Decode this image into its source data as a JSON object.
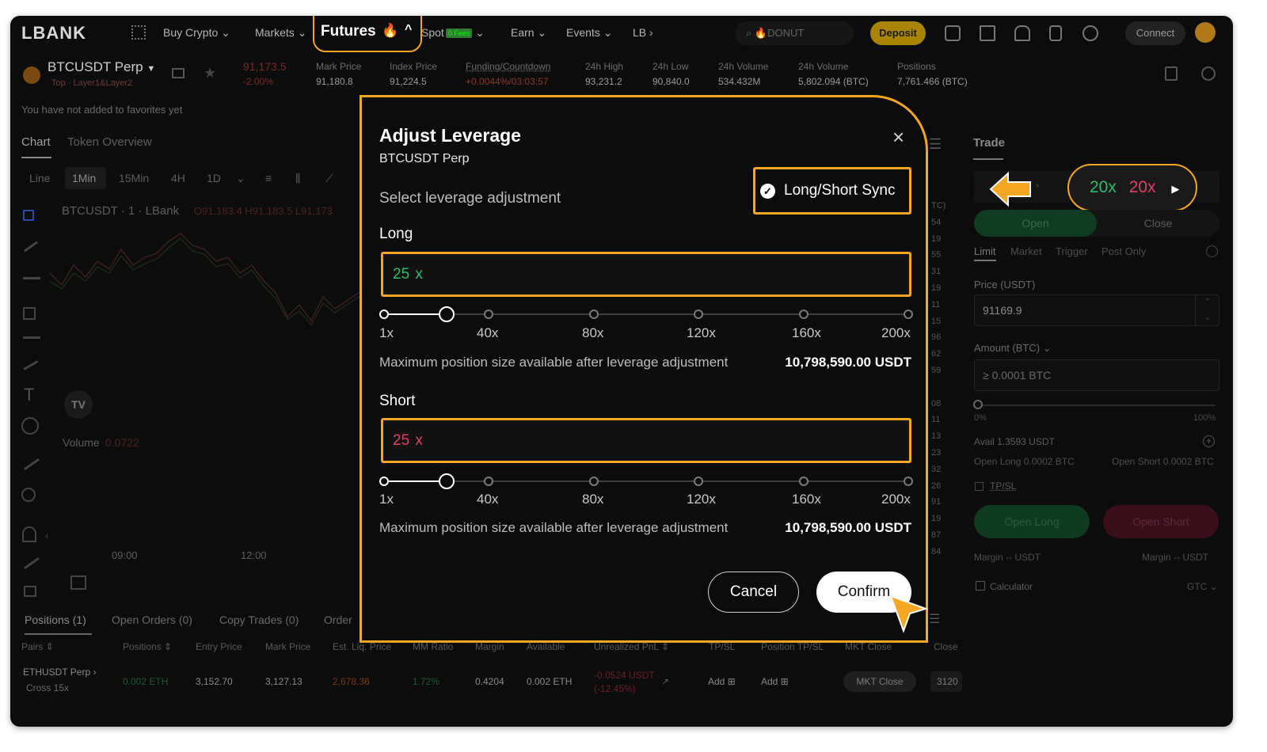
{
  "nav": {
    "logo": "LBANK",
    "items": [
      "Buy Crypto ⌄",
      "Markets ⌄",
      "Futures",
      "Spot",
      "Earn ⌄",
      "Events ⌄",
      "LB"
    ],
    "spot_badge": "0 Fees",
    "search_placeholder": "DONUT",
    "deposit": "Deposit",
    "connect": "Connect"
  },
  "ticker": {
    "symbol": "BTCUSDT Perp",
    "tags": "Top · Layer1&Layer2",
    "price": "91,173.5",
    "change": "-2.00%",
    "fields": [
      {
        "label": "Mark Price",
        "value": "91,180.8"
      },
      {
        "label": "Index Price",
        "value": "91,224.5"
      },
      {
        "label": "Funding/Countdown",
        "value": "+0.0044%/03:03:57"
      },
      {
        "label": "24h High",
        "value": "93,231.2"
      },
      {
        "label": "24h Low",
        "value": "90,840.0"
      },
      {
        "label": "24h Volume",
        "value": "534.432M"
      },
      {
        "label": "24h Volume",
        "value": "5,802.094 (BTC)"
      },
      {
        "label": "Positions",
        "value": "7,761.466 (BTC)"
      }
    ],
    "favorites_msg": "You have not added to favorites yet"
  },
  "chart": {
    "tabs": [
      "Chart",
      "Token Overview"
    ],
    "intervals": [
      "Line",
      "1Min",
      "15Min",
      "4H",
      "1D"
    ],
    "legend": "BTCUSDT · 1 · LBank",
    "ohlc": "O91,183.4  H91,183.5  L91,173",
    "volume_label": "Volume",
    "volume_value": "0.0722",
    "times": [
      "09:00",
      "12:00"
    ]
  },
  "modal": {
    "title": "Adjust Leverage",
    "subtitle": "BTCUSDT Perp",
    "select_label": "Select leverage adjustment",
    "sync_label": "Long/Short Sync",
    "long_label": "Long",
    "short_label": "Short",
    "long_value": "25",
    "short_value": "25",
    "unit": "x",
    "ticks": [
      "1x",
      "40x",
      "80x",
      "120x",
      "160x",
      "200x"
    ],
    "long_fraction": 0.12,
    "short_fraction": 0.12,
    "max_label": "Maximum position size available after leverage adjustment",
    "max_value_long": "10,798,590.00 USDT",
    "max_value_short": "10,798,590.00 USDT",
    "cancel": "Cancel",
    "confirm": "Confirm"
  },
  "trade": {
    "title": "Trade",
    "lev_long": "20x",
    "lev_short": "20x",
    "mode_fragment": "ss",
    "open": "Open",
    "close": "Close",
    "order_types": [
      "Limit",
      "Market",
      "Trigger",
      "Post Only"
    ],
    "price_label": "Price (USDT)",
    "price_value": "91169.9",
    "amount_label": "Amount (BTC) ⌄",
    "amount_placeholder": "≥ 0.0001 BTC",
    "pct_min": "0%",
    "pct_max": "100%",
    "avail": "Avail 1.3593 USDT",
    "open_long_info": "Open Long 0.0002 BTC",
    "open_short_info": "Open Short 0.0002 BTC",
    "tpsl": "TP/SL",
    "open_long_btn": "Open Long",
    "open_short_btn": "Open Short",
    "margin_left": "Margin -- USDT",
    "margin_right": "Margin -- USDT",
    "calculator": "Calculator",
    "gtc": "GTC ⌄"
  },
  "bottom": {
    "tabs": [
      "Positions (1)",
      "Open Orders (0)",
      "Copy Trades (0)",
      "Order"
    ],
    "columns": [
      "Pairs ⇕",
      "Positions ⇕",
      "Entry Price",
      "Mark Price",
      "Est. Liq. Price",
      "MM Ratio",
      "Margin",
      "Available",
      "Unrealized PnL ⇕",
      "TP/SL",
      "Position TP/SL",
      "MKT Close",
      "Close"
    ],
    "row": {
      "pair": "ETHUSDT Perp ›",
      "mode": "Cross  15x",
      "positions": "0.002 ETH",
      "entry": "3,152.70",
      "mark": "3,127.13",
      "liq": "2,678.36",
      "mm": "1.72%",
      "margin": "0.4204",
      "available": "0.002 ETH",
      "pnl": "-0.0524 USDT",
      "pnl_pct": "(-12.45%)",
      "add1": "Add ⊞",
      "add2": "Add ⊞",
      "mkt_close": "MKT Close",
      "close_val": "3120"
    }
  },
  "colors": {
    "highlight": "#f5a623",
    "long_green": "#2ebd6b",
    "short_red": "#e0426a"
  }
}
